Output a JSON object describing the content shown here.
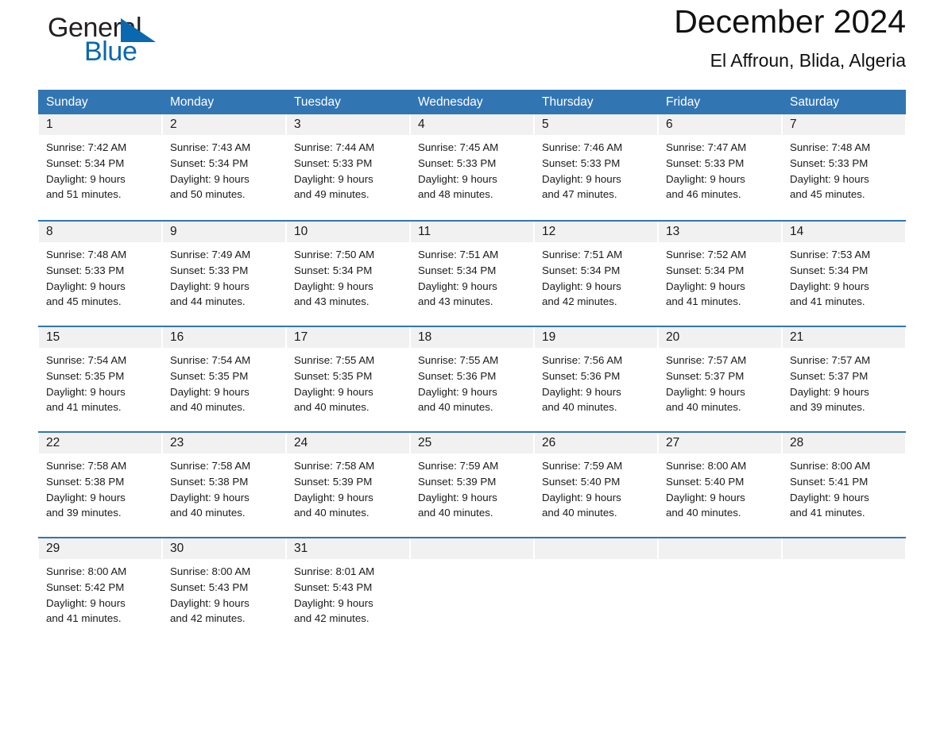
{
  "brand": {
    "line1": "General",
    "line2": "Blue",
    "triangle_color": "#0a68b0"
  },
  "header": {
    "title": "December 2024",
    "subtitle": "El Affroun, Blida, Algeria"
  },
  "colors": {
    "header_blue": "#3275b3",
    "day_band_grey": "#f1f1f1",
    "text": "#1a1a1a",
    "brand_blue": "#0a68b0"
  },
  "weekdays": [
    "Sunday",
    "Monday",
    "Tuesday",
    "Wednesday",
    "Thursday",
    "Friday",
    "Saturday"
  ],
  "weeks": [
    [
      {
        "day": "1",
        "sunrise": "Sunrise: 7:42 AM",
        "sunset": "Sunset: 5:34 PM",
        "daylight_line1": "Daylight: 9 hours",
        "daylight_line2": "and 51 minutes."
      },
      {
        "day": "2",
        "sunrise": "Sunrise: 7:43 AM",
        "sunset": "Sunset: 5:34 PM",
        "daylight_line1": "Daylight: 9 hours",
        "daylight_line2": "and 50 minutes."
      },
      {
        "day": "3",
        "sunrise": "Sunrise: 7:44 AM",
        "sunset": "Sunset: 5:33 PM",
        "daylight_line1": "Daylight: 9 hours",
        "daylight_line2": "and 49 minutes."
      },
      {
        "day": "4",
        "sunrise": "Sunrise: 7:45 AM",
        "sunset": "Sunset: 5:33 PM",
        "daylight_line1": "Daylight: 9 hours",
        "daylight_line2": "and 48 minutes."
      },
      {
        "day": "5",
        "sunrise": "Sunrise: 7:46 AM",
        "sunset": "Sunset: 5:33 PM",
        "daylight_line1": "Daylight: 9 hours",
        "daylight_line2": "and 47 minutes."
      },
      {
        "day": "6",
        "sunrise": "Sunrise: 7:47 AM",
        "sunset": "Sunset: 5:33 PM",
        "daylight_line1": "Daylight: 9 hours",
        "daylight_line2": "and 46 minutes."
      },
      {
        "day": "7",
        "sunrise": "Sunrise: 7:48 AM",
        "sunset": "Sunset: 5:33 PM",
        "daylight_line1": "Daylight: 9 hours",
        "daylight_line2": "and 45 minutes."
      }
    ],
    [
      {
        "day": "8",
        "sunrise": "Sunrise: 7:48 AM",
        "sunset": "Sunset: 5:33 PM",
        "daylight_line1": "Daylight: 9 hours",
        "daylight_line2": "and 45 minutes."
      },
      {
        "day": "9",
        "sunrise": "Sunrise: 7:49 AM",
        "sunset": "Sunset: 5:33 PM",
        "daylight_line1": "Daylight: 9 hours",
        "daylight_line2": "and 44 minutes."
      },
      {
        "day": "10",
        "sunrise": "Sunrise: 7:50 AM",
        "sunset": "Sunset: 5:34 PM",
        "daylight_line1": "Daylight: 9 hours",
        "daylight_line2": "and 43 minutes."
      },
      {
        "day": "11",
        "sunrise": "Sunrise: 7:51 AM",
        "sunset": "Sunset: 5:34 PM",
        "daylight_line1": "Daylight: 9 hours",
        "daylight_line2": "and 43 minutes."
      },
      {
        "day": "12",
        "sunrise": "Sunrise: 7:51 AM",
        "sunset": "Sunset: 5:34 PM",
        "daylight_line1": "Daylight: 9 hours",
        "daylight_line2": "and 42 minutes."
      },
      {
        "day": "13",
        "sunrise": "Sunrise: 7:52 AM",
        "sunset": "Sunset: 5:34 PM",
        "daylight_line1": "Daylight: 9 hours",
        "daylight_line2": "and 41 minutes."
      },
      {
        "day": "14",
        "sunrise": "Sunrise: 7:53 AM",
        "sunset": "Sunset: 5:34 PM",
        "daylight_line1": "Daylight: 9 hours",
        "daylight_line2": "and 41 minutes."
      }
    ],
    [
      {
        "day": "15",
        "sunrise": "Sunrise: 7:54 AM",
        "sunset": "Sunset: 5:35 PM",
        "daylight_line1": "Daylight: 9 hours",
        "daylight_line2": "and 41 minutes."
      },
      {
        "day": "16",
        "sunrise": "Sunrise: 7:54 AM",
        "sunset": "Sunset: 5:35 PM",
        "daylight_line1": "Daylight: 9 hours",
        "daylight_line2": "and 40 minutes."
      },
      {
        "day": "17",
        "sunrise": "Sunrise: 7:55 AM",
        "sunset": "Sunset: 5:35 PM",
        "daylight_line1": "Daylight: 9 hours",
        "daylight_line2": "and 40 minutes."
      },
      {
        "day": "18",
        "sunrise": "Sunrise: 7:55 AM",
        "sunset": "Sunset: 5:36 PM",
        "daylight_line1": "Daylight: 9 hours",
        "daylight_line2": "and 40 minutes."
      },
      {
        "day": "19",
        "sunrise": "Sunrise: 7:56 AM",
        "sunset": "Sunset: 5:36 PM",
        "daylight_line1": "Daylight: 9 hours",
        "daylight_line2": "and 40 minutes."
      },
      {
        "day": "20",
        "sunrise": "Sunrise: 7:57 AM",
        "sunset": "Sunset: 5:37 PM",
        "daylight_line1": "Daylight: 9 hours",
        "daylight_line2": "and 40 minutes."
      },
      {
        "day": "21",
        "sunrise": "Sunrise: 7:57 AM",
        "sunset": "Sunset: 5:37 PM",
        "daylight_line1": "Daylight: 9 hours",
        "daylight_line2": "and 39 minutes."
      }
    ],
    [
      {
        "day": "22",
        "sunrise": "Sunrise: 7:58 AM",
        "sunset": "Sunset: 5:38 PM",
        "daylight_line1": "Daylight: 9 hours",
        "daylight_line2": "and 39 minutes."
      },
      {
        "day": "23",
        "sunrise": "Sunrise: 7:58 AM",
        "sunset": "Sunset: 5:38 PM",
        "daylight_line1": "Daylight: 9 hours",
        "daylight_line2": "and 40 minutes."
      },
      {
        "day": "24",
        "sunrise": "Sunrise: 7:58 AM",
        "sunset": "Sunset: 5:39 PM",
        "daylight_line1": "Daylight: 9 hours",
        "daylight_line2": "and 40 minutes."
      },
      {
        "day": "25",
        "sunrise": "Sunrise: 7:59 AM",
        "sunset": "Sunset: 5:39 PM",
        "daylight_line1": "Daylight: 9 hours",
        "daylight_line2": "and 40 minutes."
      },
      {
        "day": "26",
        "sunrise": "Sunrise: 7:59 AM",
        "sunset": "Sunset: 5:40 PM",
        "daylight_line1": "Daylight: 9 hours",
        "daylight_line2": "and 40 minutes."
      },
      {
        "day": "27",
        "sunrise": "Sunrise: 8:00 AM",
        "sunset": "Sunset: 5:40 PM",
        "daylight_line1": "Daylight: 9 hours",
        "daylight_line2": "and 40 minutes."
      },
      {
        "day": "28",
        "sunrise": "Sunrise: 8:00 AM",
        "sunset": "Sunset: 5:41 PM",
        "daylight_line1": "Daylight: 9 hours",
        "daylight_line2": "and 41 minutes."
      }
    ],
    [
      {
        "day": "29",
        "sunrise": "Sunrise: 8:00 AM",
        "sunset": "Sunset: 5:42 PM",
        "daylight_line1": "Daylight: 9 hours",
        "daylight_line2": "and 41 minutes."
      },
      {
        "day": "30",
        "sunrise": "Sunrise: 8:00 AM",
        "sunset": "Sunset: 5:43 PM",
        "daylight_line1": "Daylight: 9 hours",
        "daylight_line2": "and 42 minutes."
      },
      {
        "day": "31",
        "sunrise": "Sunrise: 8:01 AM",
        "sunset": "Sunset: 5:43 PM",
        "daylight_line1": "Daylight: 9 hours",
        "daylight_line2": "and 42 minutes."
      },
      {
        "day": "",
        "sunrise": "",
        "sunset": "",
        "daylight_line1": "",
        "daylight_line2": ""
      },
      {
        "day": "",
        "sunrise": "",
        "sunset": "",
        "daylight_line1": "",
        "daylight_line2": ""
      },
      {
        "day": "",
        "sunrise": "",
        "sunset": "",
        "daylight_line1": "",
        "daylight_line2": ""
      },
      {
        "day": "",
        "sunrise": "",
        "sunset": "",
        "daylight_line1": "",
        "daylight_line2": ""
      }
    ]
  ]
}
